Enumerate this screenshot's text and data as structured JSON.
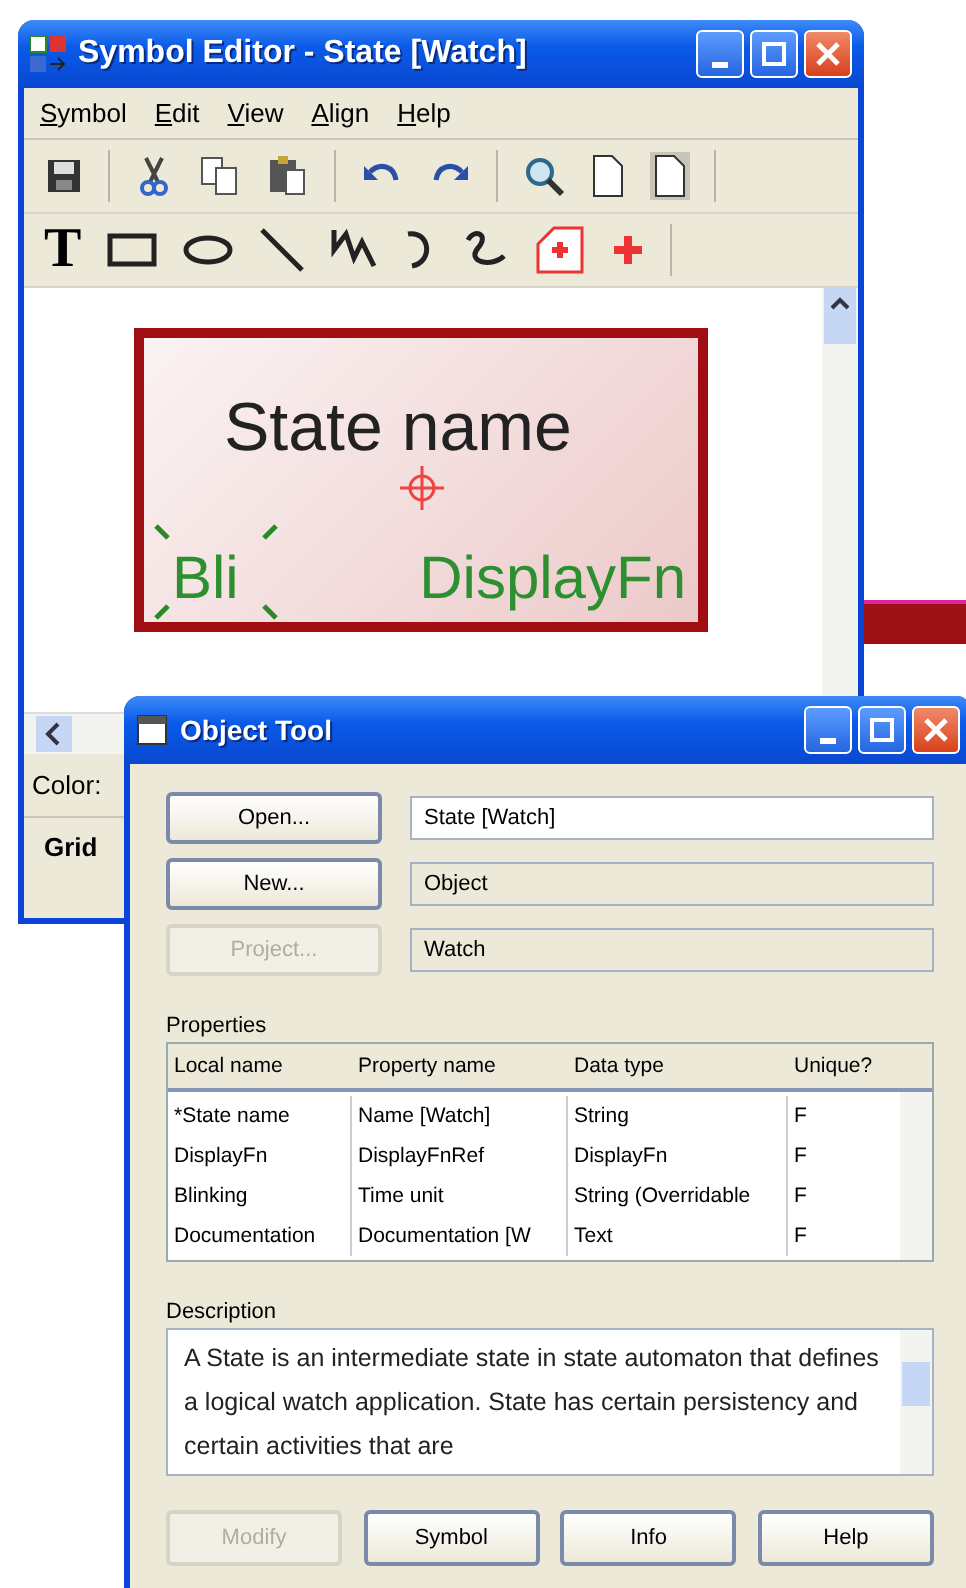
{
  "symbol_editor": {
    "title": "Symbol Editor - State [Watch]",
    "menu": [
      "Symbol",
      "Edit",
      "View",
      "Align",
      "Help"
    ],
    "text_tool_glyph": "T",
    "symbol": {
      "name_label": "State name",
      "labels": [
        "Bli",
        "DisplayFn"
      ]
    },
    "color_label": "Color:",
    "bottom_tab": "Grid"
  },
  "object_tool": {
    "title": "Object Tool",
    "rows": [
      {
        "button": "Open...",
        "button_disabled": false,
        "value": "State [Watch]",
        "editable": true
      },
      {
        "button": "New...",
        "button_disabled": false,
        "value": "Object",
        "editable": false
      },
      {
        "button": "Project...",
        "button_disabled": true,
        "value": "Watch",
        "editable": false
      }
    ],
    "properties": {
      "label": "Properties",
      "columns": [
        "Local name",
        "Property name",
        "Data type",
        "Unique?"
      ],
      "rows": [
        [
          "*State name",
          "Name [Watch]",
          "String",
          "F"
        ],
        [
          "DisplayFn",
          "DisplayFnRef",
          "DisplayFn",
          "F"
        ],
        [
          "Blinking",
          "Time unit",
          "String (Overridable",
          "F"
        ],
        [
          "Documentation",
          "Documentation [W",
          "Text",
          "F"
        ]
      ]
    },
    "description": {
      "label": "Description",
      "text": "A State is an intermediate state in state automaton that defines a logical watch application. State has certain persistency and certain activities that are"
    },
    "buttons": [
      {
        "label": "Modify",
        "disabled": true
      },
      {
        "label": "Symbol",
        "disabled": false
      },
      {
        "label": "Info",
        "disabled": false
      },
      {
        "label": "Help",
        "disabled": false
      }
    ]
  }
}
